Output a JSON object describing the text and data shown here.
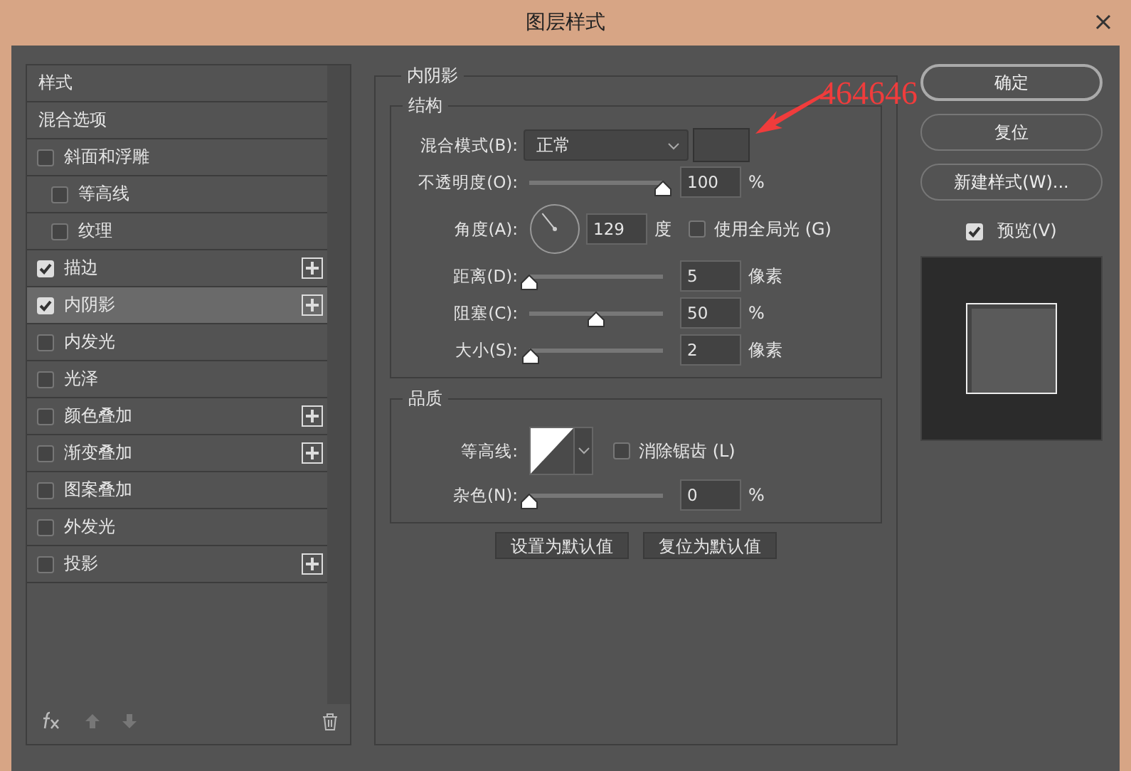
{
  "window": {
    "title": "图层样式"
  },
  "sidebar": {
    "items": [
      {
        "kind": "heading",
        "label": "样式",
        "selected": false
      },
      {
        "kind": "heading",
        "label": "混合选项",
        "selected": false
      },
      {
        "kind": "effect",
        "label": "斜面和浮雕",
        "checked": false,
        "selected": false,
        "add_button": false,
        "children": [
          {
            "kind": "effect",
            "label": "等高线",
            "checked": false,
            "selected": false,
            "add_button": false
          },
          {
            "kind": "effect",
            "label": "纹理",
            "checked": false,
            "selected": false,
            "add_button": false
          }
        ]
      },
      {
        "kind": "effect",
        "label": "描边",
        "checked": true,
        "selected": false,
        "add_button": true
      },
      {
        "kind": "effect",
        "label": "内阴影",
        "checked": true,
        "selected": true,
        "add_button": true
      },
      {
        "kind": "effect",
        "label": "内发光",
        "checked": false,
        "selected": false,
        "add_button": false
      },
      {
        "kind": "effect",
        "label": "光泽",
        "checked": false,
        "selected": false,
        "add_button": false
      },
      {
        "kind": "effect",
        "label": "颜色叠加",
        "checked": false,
        "selected": false,
        "add_button": true
      },
      {
        "kind": "effect",
        "label": "渐变叠加",
        "checked": false,
        "selected": false,
        "add_button": true
      },
      {
        "kind": "effect",
        "label": "图案叠加",
        "checked": false,
        "selected": false,
        "add_button": false
      },
      {
        "kind": "effect",
        "label": "外发光",
        "checked": false,
        "selected": false,
        "add_button": false
      },
      {
        "kind": "effect",
        "label": "投影",
        "checked": false,
        "selected": false,
        "add_button": true
      }
    ]
  },
  "panel": {
    "title": "内阴影",
    "sections": [
      {
        "title": "结构",
        "rows": [
          {
            "kind": "select",
            "label": "混合模式(B):",
            "value": "正常",
            "color": "#464646"
          },
          {
            "kind": "slider",
            "label": "不透明度(O):",
            "level": 1,
            "value": "100",
            "unit": "%"
          },
          {
            "kind": "angle",
            "label": "角度(A):",
            "value": "129",
            "unit": "度",
            "checkbox": {
              "label": "使用全局光 (G)",
              "checked": false
            }
          },
          {
            "kind": "slider",
            "label": "距离(D):",
            "level": 0,
            "value": "5",
            "unit": "像素"
          },
          {
            "kind": "slider",
            "label": "阻塞(C):",
            "level": 0.5,
            "value": "50",
            "unit": "%"
          },
          {
            "kind": "slider",
            "label": "大小(S):",
            "level": 0.01,
            "value": "2",
            "unit": "像素"
          }
        ]
      },
      {
        "title": "品质",
        "rows": [
          {
            "kind": "contour",
            "label": "等高线:",
            "checkbox": {
              "label": "消除锯齿 (L)",
              "checked": false
            }
          },
          {
            "kind": "slider",
            "label": "杂色(N):",
            "level": 0,
            "value": "0",
            "unit": "%"
          }
        ]
      }
    ],
    "buttons": [
      "设置为默认值",
      "复位为默认值"
    ]
  },
  "actions": {
    "buttons": [
      {
        "label": "确定",
        "default": true
      },
      {
        "label": "复位",
        "default": false
      },
      {
        "label": "新建样式(W)...",
        "default": false
      }
    ],
    "preview": {
      "label": "预览(V)",
      "checked": true
    }
  },
  "annotation": {
    "text": "464646"
  }
}
